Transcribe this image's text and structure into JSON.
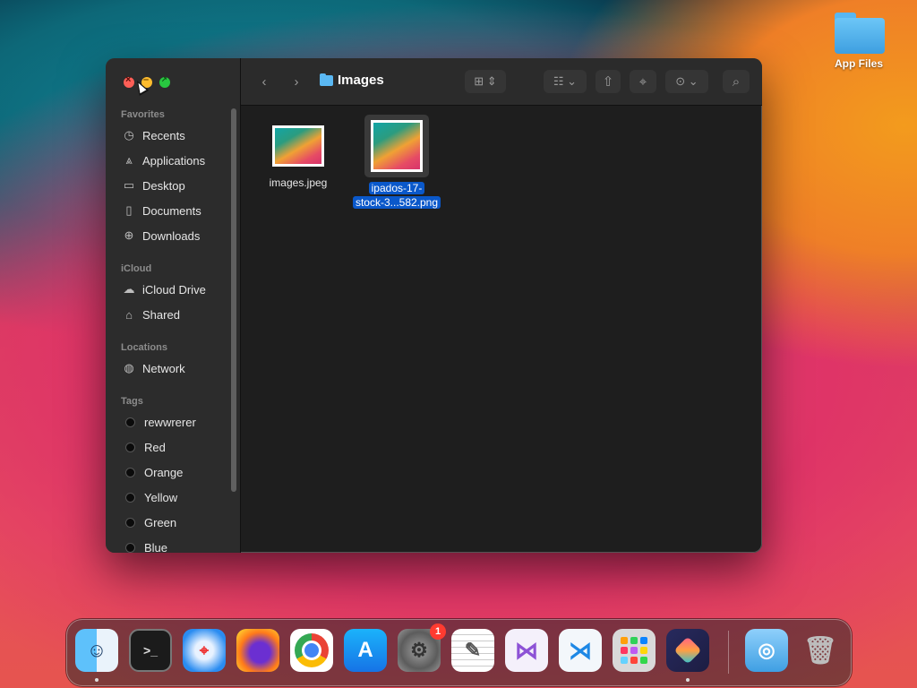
{
  "desktop": {
    "folder_label": "App Files"
  },
  "window": {
    "title": "Images",
    "sidebar": {
      "sections": [
        {
          "label": "Favorites",
          "items": [
            {
              "label": "Recents",
              "icon": "clock-icon"
            },
            {
              "label": "Applications",
              "icon": "applications-icon"
            },
            {
              "label": "Desktop",
              "icon": "desktop-icon"
            },
            {
              "label": "Documents",
              "icon": "document-icon"
            },
            {
              "label": "Downloads",
              "icon": "download-icon"
            }
          ]
        },
        {
          "label": "iCloud",
          "items": [
            {
              "label": "iCloud Drive",
              "icon": "cloud-icon"
            },
            {
              "label": "Shared",
              "icon": "shared-folder-icon"
            }
          ]
        },
        {
          "label": "Locations",
          "items": [
            {
              "label": "Network",
              "icon": "globe-icon"
            }
          ]
        },
        {
          "label": "Tags",
          "items": [
            {
              "label": "rewwrerer"
            },
            {
              "label": "Red"
            },
            {
              "label": "Orange"
            },
            {
              "label": "Yellow"
            },
            {
              "label": "Green"
            },
            {
              "label": "Blue"
            }
          ]
        }
      ]
    },
    "files": [
      {
        "name": "images.jpeg",
        "selected": false
      },
      {
        "name_line1": "ipados-17-",
        "name_line2": "stock-3...582.png",
        "selected": true
      }
    ]
  },
  "dock": {
    "apps": [
      "Finder",
      "Terminal",
      "Safari",
      "Firefox",
      "Chrome",
      "App Store",
      "System Settings",
      "TextEdit",
      "Visual Studio",
      "VS Code",
      "Launchpad",
      "Shortcuts",
      "Downloads",
      "Trash"
    ],
    "settings_badge": "1"
  },
  "colors": {
    "selection": "#0a58ca",
    "folder_blue": "#5ab8f3"
  }
}
